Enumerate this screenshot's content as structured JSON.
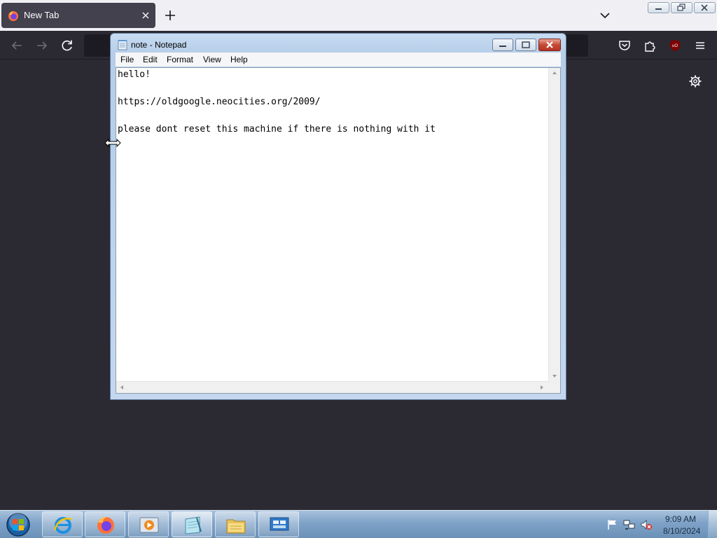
{
  "firefox": {
    "tab_title": "New Tab",
    "tab_icon": "firefox-logo-icon",
    "toolbar_icons": [
      "back-arrow-icon",
      "forward-arrow-icon",
      "reload-icon",
      "pocket-icon",
      "extensions-icon",
      "ublock-icon",
      "hamburger-menu-icon"
    ],
    "settings_icon": "gear-icon",
    "ublock_label": "uO"
  },
  "notepad": {
    "title": "note - Notepad",
    "menu": [
      "File",
      "Edit",
      "Format",
      "View",
      "Help"
    ],
    "content": "hello!\n\nhttps://oldgoogle.neocities.org/2009/\n\nplease dont reset this machine if there is nothing with it"
  },
  "taskbar": {
    "apps": [
      "internet-explorer-icon",
      "firefox-icon",
      "media-player-icon",
      "notepad-icon",
      "file-explorer-icon",
      "control-panel-icon"
    ],
    "clock_time": "9:09 AM",
    "clock_date": "8/10/2024"
  },
  "colors": {
    "firefox_dark": "#2b2a33",
    "tabbar_light": "#f0f0f4",
    "taskbar_blue": "#7ea2c7",
    "close_red": "#c64a35"
  }
}
